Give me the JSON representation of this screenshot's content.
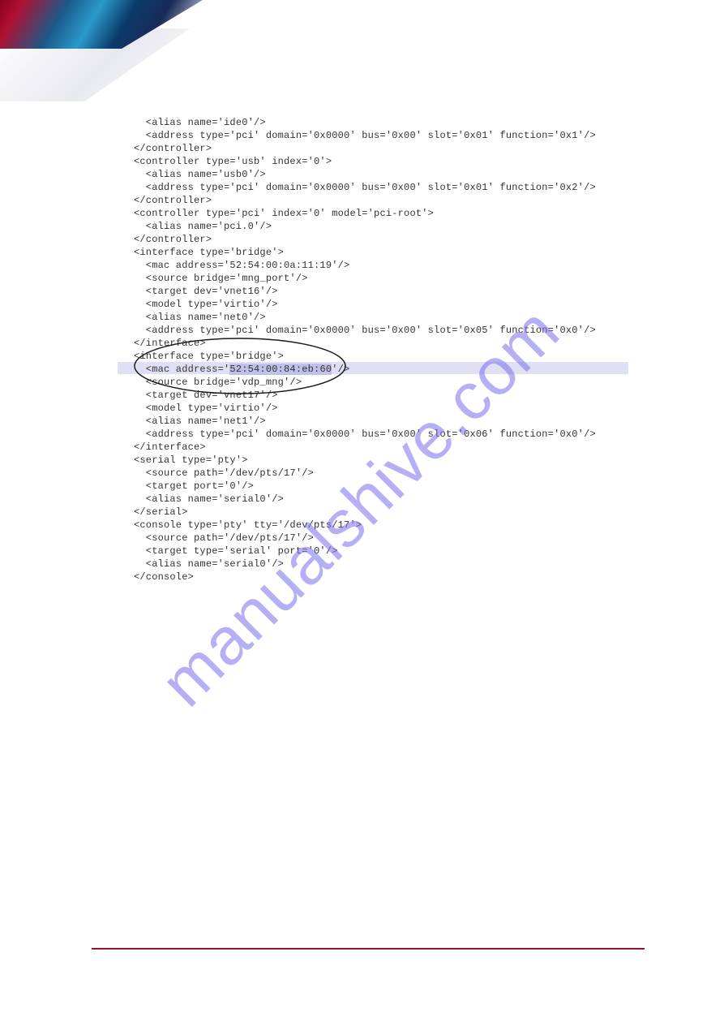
{
  "watermark": "manualshive.com",
  "highlighted_mac": "52:54:00:84:eb:60",
  "code_lines": [
    "  <alias name='ide0'/>",
    "  <address type='pci' domain='0x0000' bus='0x00' slot='0x01' function='0x1'/>",
    "</controller>",
    "<controller type='usb' index='0'>",
    "  <alias name='usb0'/>",
    "  <address type='pci' domain='0x0000' bus='0x00' slot='0x01' function='0x2'/>",
    "</controller>",
    "<controller type='pci' index='0' model='pci-root'>",
    "  <alias name='pci.0'/>",
    "</controller>",
    "<interface type='bridge'>",
    "  <mac address='52:54:00:0a:11:19'/>",
    "  <source bridge='mng_port'/>",
    "  <target dev='vnet16'/>",
    "  <model type='virtio'/>",
    "  <alias name='net0'/>",
    "  <address type='pci' domain='0x0000' bus='0x00' slot='0x05' function='0x0'/>",
    "</interface>",
    "<interface type='bridge'>",
    "  <mac address='",
    "'/>",
    "  <source bridge='vdp_mng'/>",
    "  <target dev='vnet17'/>",
    "  <model type='virtio'/>",
    "  <alias name='net1'/>",
    "  <address type='pci' domain='0x0000' bus='0x00' slot='0x06' function='0x0'/>",
    "</interface>",
    "<serial type='pty'>",
    "  <source path='/dev/pts/17'/>",
    "  <target port='0'/>",
    "  <alias name='serial0'/>",
    "</serial>",
    "<console type='pty' tty='/dev/pts/17'>",
    "  <source path='/dev/pts/17'/>",
    "  <target type='serial' port='0'/>",
    "  <alias name='serial0'/>",
    "</console>"
  ]
}
